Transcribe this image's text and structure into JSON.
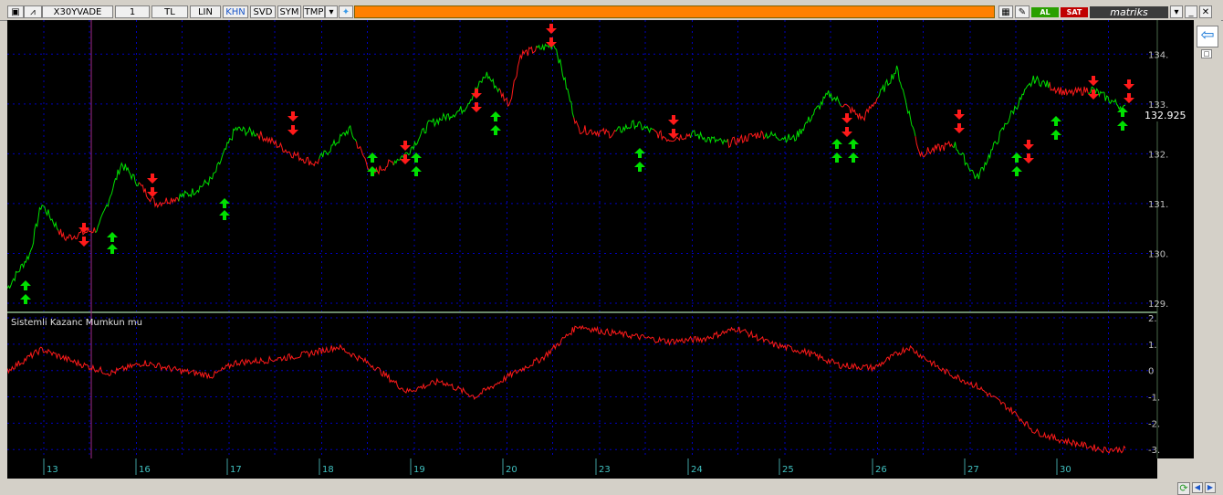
{
  "toolbar": {
    "symbol": "X30YVADE",
    "period": "1",
    "currency": "TL",
    "scale": "LIN",
    "khn": "KHN",
    "svd": "SVD",
    "sym": "SYM",
    "tmp": "TMP",
    "al_label": "AL",
    "sat_label": "SAT",
    "brand": "matriks"
  },
  "price_panel": {
    "current_value": "132.925",
    "y_ticks": [
      "134.",
      "133.",
      "132.",
      "131.",
      "130.",
      "129."
    ]
  },
  "indicator_panel": {
    "title": "Sistemli Kazanc Mumkun mu",
    "y_ticks": [
      "2.",
      "1.",
      "0",
      "-1.",
      "-2.",
      "-3."
    ]
  },
  "x_axis": {
    "days": [
      "13",
      "16",
      "17",
      "18",
      "19",
      "20",
      "23",
      "24",
      "25",
      "26",
      "27",
      "30"
    ]
  },
  "chart_data": {
    "type": "line",
    "series": [
      {
        "name": "price",
        "x": [
          0,
          0.02,
          0.03,
          0.05,
          0.08,
          0.1,
          0.13,
          0.16,
          0.18,
          0.2,
          0.22,
          0.25,
          0.27,
          0.3,
          0.32,
          0.35,
          0.37,
          0.4,
          0.42,
          0.44,
          0.45,
          0.48,
          0.5,
          0.53,
          0.55,
          0.58,
          0.6,
          0.63,
          0.66,
          0.69,
          0.72,
          0.75,
          0.78,
          0.8,
          0.83,
          0.85,
          0.88,
          0.9,
          0.93,
          0.95,
          0.98
        ],
        "values": [
          129.3,
          130.0,
          131.0,
          130.3,
          130.5,
          131.8,
          131.0,
          131.2,
          131.5,
          132.5,
          132.4,
          132.0,
          131.8,
          132.5,
          131.6,
          132.0,
          132.6,
          132.9,
          133.6,
          133.0,
          134.0,
          134.2,
          132.5,
          132.4,
          132.6,
          132.3,
          132.4,
          132.2,
          132.4,
          132.3,
          133.2,
          132.7,
          133.7,
          132.0,
          132.2,
          131.5,
          132.8,
          133.5,
          133.2,
          133.3,
          132.9
        ]
      },
      {
        "name": "Sistemli Kazanc Mumkun mu",
        "x": [
          0,
          0.03,
          0.06,
          0.09,
          0.12,
          0.15,
          0.18,
          0.2,
          0.23,
          0.26,
          0.29,
          0.32,
          0.35,
          0.38,
          0.41,
          0.44,
          0.47,
          0.5,
          0.52,
          0.55,
          0.58,
          0.61,
          0.64,
          0.67,
          0.7,
          0.73,
          0.76,
          0.79,
          0.82,
          0.85,
          0.88,
          0.9,
          0.92,
          0.94,
          0.96,
          0.98
        ],
        "values": [
          0,
          0.8,
          0.3,
          -0.1,
          0.3,
          0.0,
          -0.2,
          0.3,
          0.4,
          0.6,
          0.9,
          0.2,
          -0.8,
          -0.4,
          -1.0,
          -0.2,
          0.5,
          1.7,
          1.5,
          1.3,
          1.1,
          1.2,
          1.6,
          1.0,
          0.7,
          0.2,
          0.1,
          0.9,
          0.0,
          -0.6,
          -1.5,
          -2.3,
          -2.6,
          -2.8,
          -3.0,
          -3.0
        ]
      }
    ],
    "colors": {
      "up": "#00e000",
      "down": "#ff1a1a",
      "buy_arrow": "#00e000",
      "sell_arrow": "#ff1a1a",
      "grid": "#0000c0",
      "axis_text": "#c0c0c0"
    }
  }
}
